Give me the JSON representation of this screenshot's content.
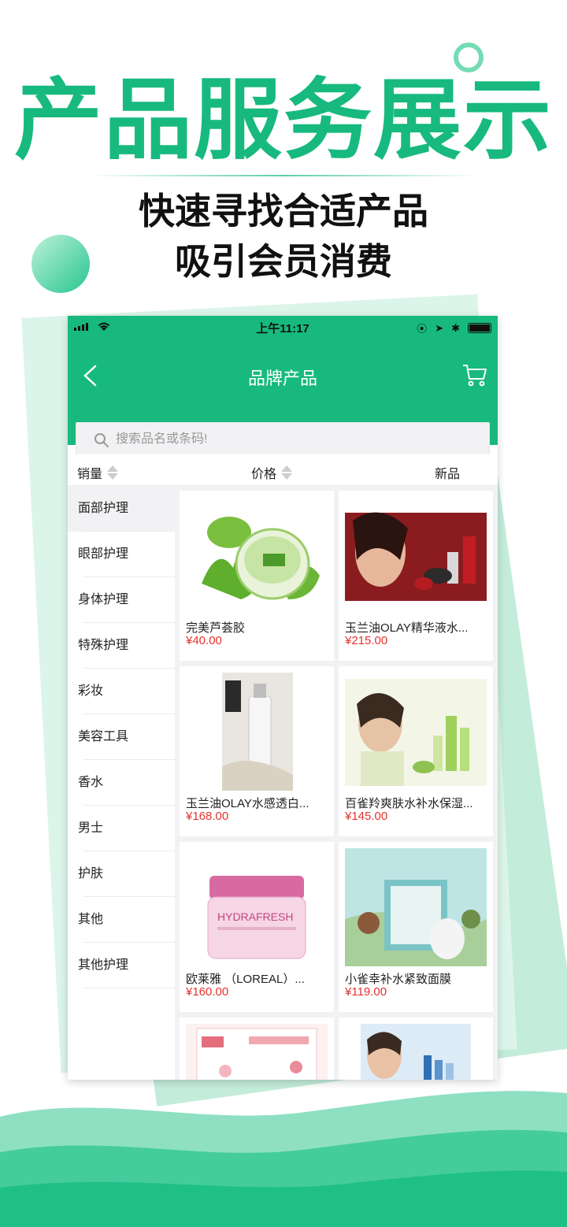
{
  "hero": {
    "title": "产品服务展示",
    "subtitle_line1": "快速寻找合适产品",
    "subtitle_line2": "吸引会员消费"
  },
  "status_bar": {
    "time": "上午11:17"
  },
  "navbar": {
    "title": "品牌产品",
    "back_icon": "chevron-left-icon",
    "cart_icon": "cart-icon"
  },
  "search": {
    "placeholder": "搜索品名或条码!"
  },
  "sort_bar": {
    "sales": "销量",
    "price": "价格",
    "new": "新品"
  },
  "categories": [
    {
      "label": "面部护理",
      "active": true
    },
    {
      "label": "眼部护理"
    },
    {
      "label": "身体护理"
    },
    {
      "label": "特殊护理"
    },
    {
      "label": "彩妆"
    },
    {
      "label": "美容工具"
    },
    {
      "label": "香水"
    },
    {
      "label": "男士"
    },
    {
      "label": "护肤"
    },
    {
      "label": "其他"
    },
    {
      "label": "其他护理"
    }
  ],
  "products": [
    {
      "name": "完美芦荟胶",
      "price": "¥40.00"
    },
    {
      "name": "玉兰油OLAY精华液水...",
      "price": "¥215.00"
    },
    {
      "name": "玉兰油OLAY水感透白...",
      "price": "¥168.00"
    },
    {
      "name": "百雀羚爽肤水补水保湿...",
      "price": "¥145.00"
    },
    {
      "name": "欧莱雅 （LOREAL）...",
      "price": "¥160.00"
    },
    {
      "name": "小雀幸补水紧致面膜",
      "price": "¥119.00"
    },
    {
      "name": "",
      "price": ""
    },
    {
      "name": "",
      "price": ""
    }
  ],
  "colors": {
    "brand": "#17b97f",
    "price": "#e5322d"
  }
}
